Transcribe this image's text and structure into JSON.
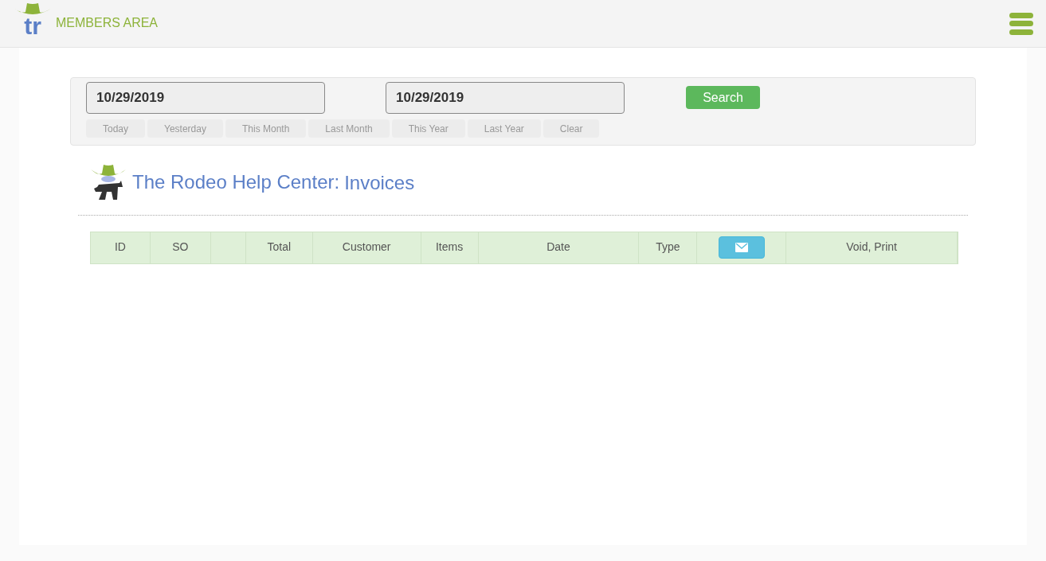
{
  "header": {
    "logo_text": "tr",
    "title": "MEMBERS AREA"
  },
  "filter": {
    "start_date": "10/29/2019",
    "end_date": "10/29/2019",
    "search_button": "Search",
    "presets": [
      "Today",
      "Yesterday",
      "This Month",
      "Last Month",
      "This Year",
      "Last Year",
      "Clear"
    ]
  },
  "heading": {
    "title": "The Rodeo Help Center:",
    "subtitle": "Invoices"
  },
  "table": {
    "columns": [
      {
        "kind": "text",
        "label": "ID"
      },
      {
        "kind": "text",
        "label": "SO"
      },
      {
        "kind": "blank"
      },
      {
        "kind": "text",
        "label": "Total"
      },
      {
        "kind": "text",
        "label": "Customer"
      },
      {
        "kind": "text",
        "label": "Items"
      },
      {
        "kind": "text",
        "label": "Date"
      },
      {
        "kind": "text",
        "label": "Type"
      },
      {
        "kind": "email_button"
      },
      {
        "kind": "text",
        "label": "Void, Print"
      }
    ]
  }
}
